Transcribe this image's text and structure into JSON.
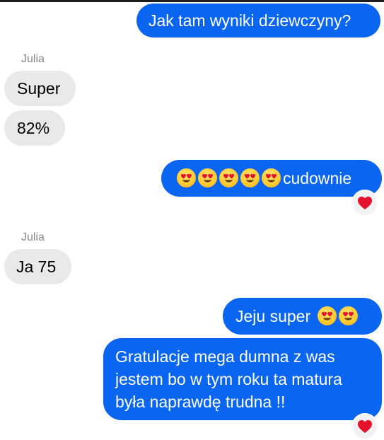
{
  "colors": {
    "outgoing_bubble": "#0a66f0",
    "incoming_bubble": "#e9e9eb",
    "sender_label": "#86868b",
    "reaction_heart": "#e3122d"
  },
  "messages": {
    "m1": {
      "direction": "outgoing",
      "text": "Jak tam wyniki dziewczyny?"
    },
    "sender1": "Julia",
    "m2": {
      "direction": "incoming",
      "text": "Super"
    },
    "m3": {
      "direction": "incoming",
      "text": "82%"
    },
    "m4": {
      "direction": "outgoing",
      "emoji": [
        "heart-eyes-emoji",
        "heart-eyes-emoji",
        "heart-eyes-emoji",
        "heart-eyes-emoji",
        "heart-eyes-emoji"
      ],
      "text": "cudownie",
      "reaction": "heart-icon"
    },
    "sender2": "Julia",
    "m5": {
      "direction": "incoming",
      "text": "Ja 75"
    },
    "m6": {
      "direction": "outgoing",
      "text": "Jeju super",
      "emoji": [
        "heart-eyes-emoji",
        "heart-eyes-emoji"
      ]
    },
    "m7": {
      "direction": "outgoing",
      "lines": [
        "Gratulacje mega dumna z was",
        "jestem bo w tym roku ta matura",
        "była naprawdę trudna !!"
      ],
      "reaction": "heart-icon"
    }
  }
}
